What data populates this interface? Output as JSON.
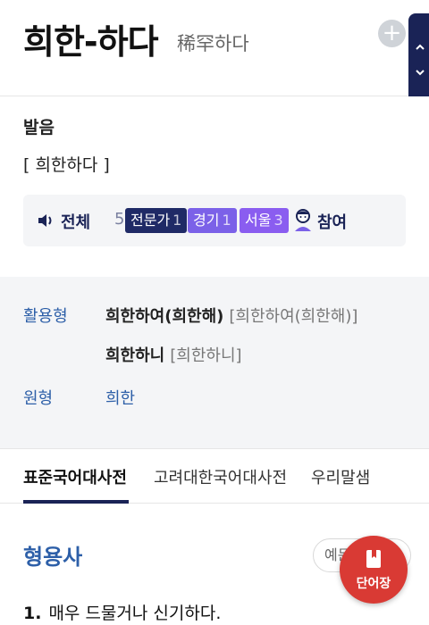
{
  "entry": {
    "word": "희한-하다",
    "hanja": "稀罕하다"
  },
  "pronunciation": {
    "title": "발음",
    "value": "[ 희한하다 ]"
  },
  "votes": {
    "all_label": "전체",
    "all_count": "5",
    "chips": [
      {
        "label": "전문가",
        "count": "1",
        "color": "#1f2a66"
      },
      {
        "label": "경기",
        "count": "1",
        "color": "#7b61e8"
      },
      {
        "label": "서울",
        "count": "3",
        "color": "#8a5df0"
      }
    ],
    "join_label": "참여"
  },
  "forms": {
    "conjugation_label": "활용형",
    "conjugations": [
      {
        "form": "희한하여(희한해)",
        "pron": "[희한하여(희한해)]"
      },
      {
        "form": "희한하니",
        "pron": "[희한하니]"
      }
    ],
    "base_label": "원형",
    "base_value": "희한"
  },
  "tabs": [
    {
      "label": "표준국어대사전",
      "active": true
    },
    {
      "label": "고려대한국어대사전",
      "active": false
    },
    {
      "label": "우리말샘",
      "active": false
    }
  ],
  "definition": {
    "pos": "형용사",
    "example_button": "예문",
    "items": [
      {
        "num": "1.",
        "text": "매우 드물거나 신기하다."
      }
    ]
  },
  "fab": {
    "label": "단어장"
  },
  "icons": {
    "plus": "plus-circle-icon",
    "scroll_up": "chevron-up-icon",
    "scroll_down": "chevron-down-icon",
    "speaker": "speaker-icon",
    "person": "person-icon",
    "bookmark": "bookmark-icon"
  },
  "colors": {
    "navy": "#1a2356",
    "link_blue": "#2d5fa8",
    "fab_red": "#d93a34"
  }
}
